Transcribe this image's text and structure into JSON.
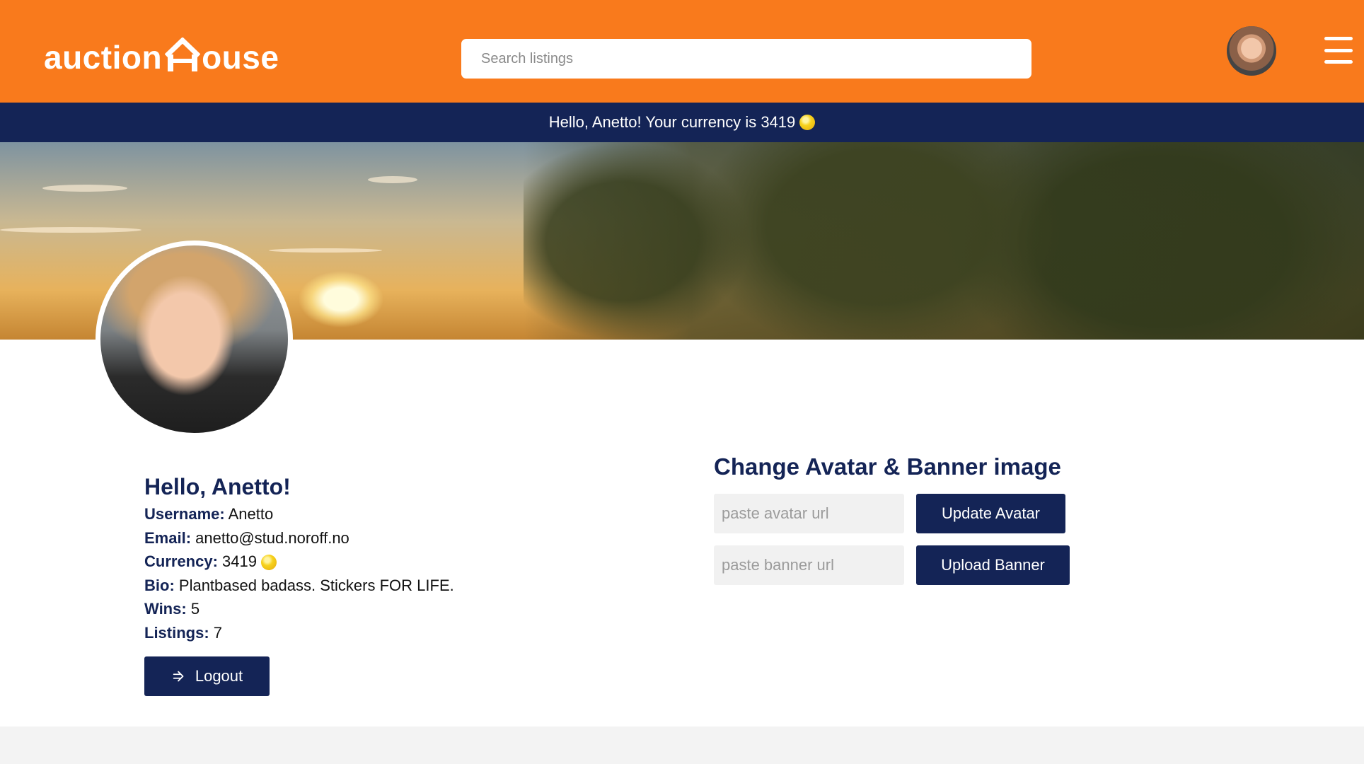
{
  "header": {
    "logo_left": "auction",
    "logo_right": "ouse",
    "search_placeholder": "Search listings",
    "brand_color": "#f97a1c"
  },
  "greeting_bar": {
    "text": "Hello, Anetto! Your currency is 3419",
    "background": "#142456",
    "coin_icon": "coin-icon"
  },
  "profile": {
    "greeting": "Hello, Anetto!",
    "fields": [
      {
        "label": "Username:",
        "value": "Anetto"
      },
      {
        "label": "Email:",
        "value": "anetto@stud.noroff.no"
      },
      {
        "label": "Currency:",
        "value": "3419"
      },
      {
        "label": "Bio:",
        "value": "Plantbased badass. Stickers FOR LIFE."
      },
      {
        "label": "Wins:",
        "value": "5"
      },
      {
        "label": "Listings:",
        "value": "7"
      }
    ],
    "logout_label": "Logout"
  },
  "change_images": {
    "title": "Change Avatar & Banner image",
    "avatar_placeholder": "paste avatar url",
    "avatar_button": "Update Avatar",
    "banner_placeholder": "paste banner url",
    "banner_button": "Upload Banner"
  }
}
